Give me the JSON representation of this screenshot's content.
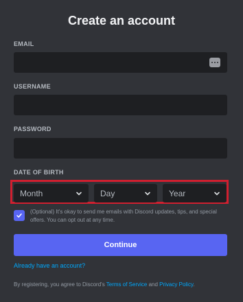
{
  "title": "Create an account",
  "form": {
    "email_label": "EMAIL",
    "email_value": "",
    "username_label": "USERNAME",
    "username_value": "",
    "password_label": "PASSWORD",
    "password_value": "",
    "dob_label": "DATE OF BIRTH",
    "month_placeholder": "Month",
    "day_placeholder": "Day",
    "year_placeholder": "Year",
    "optin_checked": true,
    "optin_text": "(Optional) It's okay to send me emails with Discord updates, tips, and special offers. You can opt out at any time.",
    "continue_label": "Continue",
    "login_link": "Already have an account?"
  },
  "legal": {
    "prefix": "By registering, you agree to Discord's ",
    "tos": "Terms of Service",
    "and": " and ",
    "privacy": "Privacy Policy",
    "suffix": "."
  },
  "colors": {
    "background": "#313338",
    "input": "#1e1f22",
    "accent": "#5865f2",
    "link": "#00a8fc",
    "highlight_border": "#d01f2f"
  },
  "icons": {
    "password_manager": "keyboard-dots-icon",
    "dropdown": "chevron-down-icon",
    "checkbox": "checkmark-icon"
  }
}
